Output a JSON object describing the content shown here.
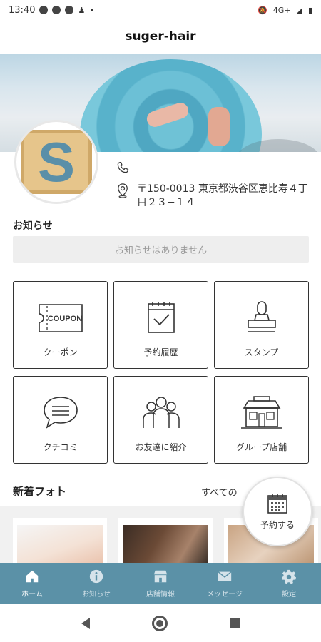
{
  "status_bar": {
    "time": "13:40",
    "network": "4G+"
  },
  "app_bar": {
    "title": "suger-hair"
  },
  "profile": {
    "avatar_letter": "S",
    "address": "〒150-0013 東京都渋谷区恵比寿４丁目２３−１４"
  },
  "notice": {
    "title": "お知らせ",
    "empty_message": "お知らせはありません"
  },
  "menu": {
    "coupon": "クーポン",
    "coupon_icon_text": "COUPON",
    "history": "予約履歴",
    "stamp": "スタンプ",
    "review": "クチコミ",
    "refer": "お友達に紹介",
    "group": "グループ店舗"
  },
  "photos": {
    "title": "新着フォト",
    "see_all": "すべての"
  },
  "fab": {
    "label": "予約する"
  },
  "tabs": {
    "home": "ホーム",
    "news": "お知らせ",
    "store": "店舗情報",
    "message": "メッセージ",
    "settings": "設定"
  },
  "colors": {
    "tab_bar": "#5b91a7",
    "notice_box": "#eeeeee"
  }
}
